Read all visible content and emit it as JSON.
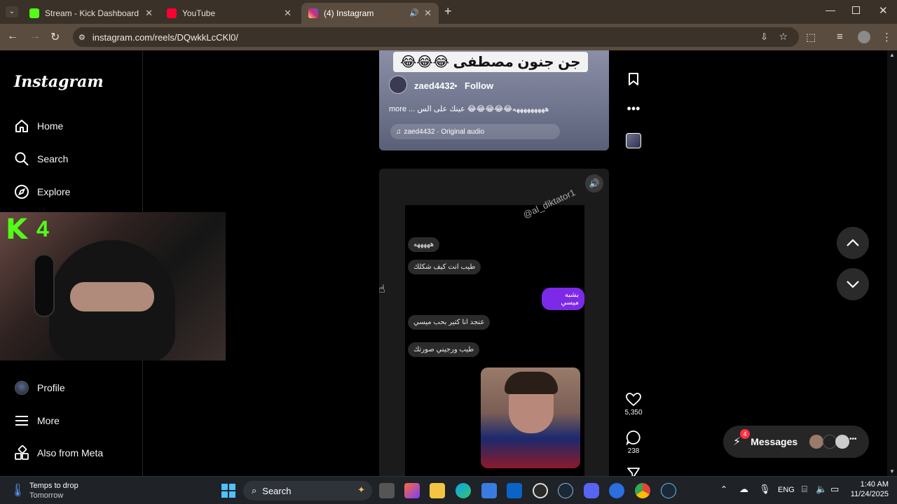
{
  "browser": {
    "tabs": [
      {
        "title": "Stream - Kick Dashboard",
        "icon": "kick-icon",
        "color": "#53fc18"
      },
      {
        "title": "YouTube",
        "icon": "youtube-icon",
        "color": "#ff0033"
      },
      {
        "title": "(4) Instagram",
        "icon": "instagram-icon",
        "color": "#d6249f"
      }
    ],
    "url": "instagram.com/reels/DQwkkLcCKl0/"
  },
  "instagram": {
    "logo": "Instagram",
    "nav": [
      {
        "label": "Home",
        "icon": "home-icon"
      },
      {
        "label": "Search",
        "icon": "search-icon"
      },
      {
        "label": "Explore",
        "icon": "compass-icon"
      },
      {
        "label": "Profile",
        "icon": "avatar-icon"
      },
      {
        "label": "More",
        "icon": "menu-icon"
      },
      {
        "label": "Also from Meta",
        "icon": "meta-grid-icon"
      }
    ]
  },
  "webcam": {
    "badge": "4",
    "watermark": "K"
  },
  "reel1": {
    "overlay_text": "جن جنون مصطفى 😂😂😂",
    "username": "zaed4432",
    "dot": "•",
    "follow": "Follow",
    "caption": "هههههههههه😂😂😂😂😂 عينك على الس ... more",
    "audio": "zaed4432 · Original audio"
  },
  "reel2": {
    "watermark": "@al_diktator1",
    "messages": [
      {
        "text": "هههههه",
        "side": "left"
      },
      {
        "text": "طيب انت كيف شكلك",
        "side": "left"
      },
      {
        "text": "بشبه ميسي",
        "side": "right"
      },
      {
        "text": "عنجد انا كتير بحب ميسي",
        "side": "left"
      },
      {
        "text": "طيب ورجيني صورتك",
        "side": "left"
      }
    ]
  },
  "actions": {
    "likes": "5,350",
    "comments": "238"
  },
  "messages_bar": {
    "label": "Messages",
    "badge": "4"
  },
  "taskbar": {
    "weather_title": "Temps to drop",
    "weather_sub": "Tomorrow",
    "search": "Search",
    "lang": "ENG",
    "time": "1:40 AM",
    "date": "11/24/2025"
  }
}
